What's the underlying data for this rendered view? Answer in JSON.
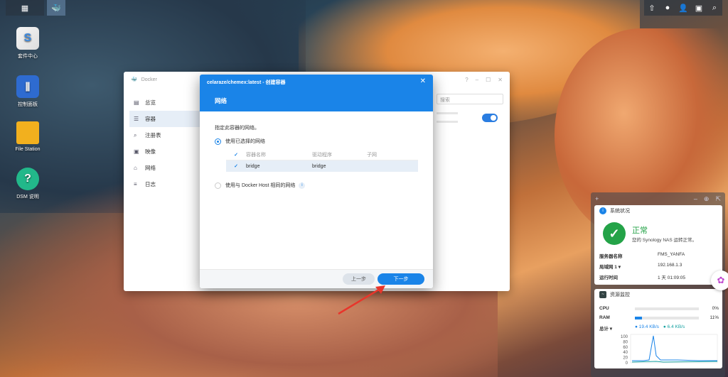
{
  "desktop": {
    "icons": [
      {
        "label": "套件中心",
        "icon": "package-center-icon"
      },
      {
        "label": "控制面板",
        "icon": "control-panel-icon"
      },
      {
        "label": "File Station",
        "icon": "folder-icon"
      },
      {
        "label": "DSM 说明",
        "icon": "help-icon"
      }
    ]
  },
  "docker": {
    "title": "Docker",
    "search_placeholder": "搜索",
    "nav": [
      {
        "label": "总览",
        "icon": "overview-icon"
      },
      {
        "label": "容器",
        "icon": "container-icon"
      },
      {
        "label": "注册表",
        "icon": "registry-icon"
      },
      {
        "label": "映像",
        "icon": "image-icon"
      },
      {
        "label": "网络",
        "icon": "network-icon"
      },
      {
        "label": "日志",
        "icon": "log-icon"
      }
    ]
  },
  "wizard": {
    "breadcrumb": "celaraze/chemex:latest - 创建容器",
    "step_title": "网络",
    "description": "指定此容器的网络。",
    "option_selected": "使用已选择的网络",
    "option_host": "使用与 Docker Host 相同的网络",
    "table": {
      "headers": [
        "容器名称",
        "驱动程序",
        "子网"
      ],
      "rows": [
        [
          "bridge",
          "bridge",
          ""
        ]
      ]
    },
    "prev_label": "上一步",
    "next_label": "下一步"
  },
  "system_status": {
    "title": "系统状况",
    "status": "正常",
    "status_detail": "您的 Synology NAS 运转正常。",
    "rows": [
      {
        "key": "服务器名称",
        "value": "FMS_YANFA"
      },
      {
        "key": "局域网 1 ▾",
        "value": "192.168.1.3"
      },
      {
        "key": "运行时间",
        "value": "1 天 01:09:05"
      }
    ]
  },
  "resource_monitor": {
    "title": "资源监控",
    "cpu": {
      "label": "CPU",
      "value": "0%",
      "fraction": 0.0
    },
    "ram": {
      "label": "RAM",
      "value": "11%",
      "fraction": 0.11
    },
    "total_label": "总计 ▾",
    "upload": "19.4 KB/s",
    "download": "6.4 KB/s",
    "y_ticks": [
      "100",
      "80",
      "60",
      "40",
      "20",
      "0"
    ]
  },
  "colors": {
    "accent": "#1a84e8",
    "ok": "#24a348"
  }
}
